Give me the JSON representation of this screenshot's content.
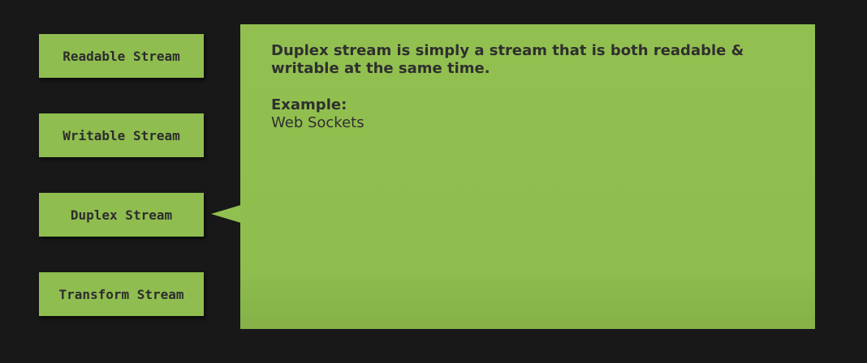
{
  "streams": [
    {
      "label": "Readable Stream"
    },
    {
      "label": "Writable Stream"
    },
    {
      "label": "Duplex Stream"
    },
    {
      "label": "Transform Stream"
    }
  ],
  "selected_stream": "Duplex Stream",
  "panel": {
    "description": "Duplex stream is simply a stream that is both readable & writable at the same time.",
    "example_label": "Example:",
    "example_value": "Web Sockets"
  },
  "colors": {
    "background": "#181818",
    "box": "#8fbd4f",
    "panel": "#92c050",
    "text": "#2f2f2f"
  }
}
